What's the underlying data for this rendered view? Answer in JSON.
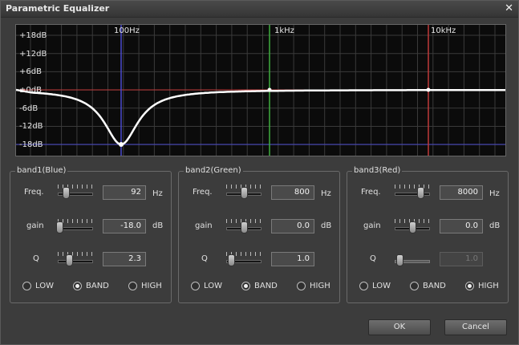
{
  "window": {
    "title": "Parametric Equalizer",
    "close_symbol": "✕"
  },
  "graph": {
    "y_labels": [
      "+18dB",
      "+12dB",
      "+6dB",
      "±0dB",
      "-6dB",
      "-12dB",
      "-18dB"
    ],
    "x_labels": [
      "100Hz",
      "1kHz",
      "10kHz"
    ]
  },
  "bands": [
    {
      "title": "band1(Blue)",
      "freq_label": "Freq.",
      "freq_value": "92",
      "freq_unit": "Hz",
      "gain_label": "gain",
      "gain_value": "-18.0",
      "gain_unit": "dB",
      "q_label": "Q",
      "q_value": "2.3",
      "type_options": [
        "LOW",
        "BAND",
        "HIGH"
      ],
      "selected_type": "BAND",
      "color": "#4a4acc"
    },
    {
      "title": "band2(Green)",
      "freq_label": "Freq.",
      "freq_value": "800",
      "freq_unit": "Hz",
      "gain_label": "gain",
      "gain_value": "0.0",
      "gain_unit": "dB",
      "q_label": "Q",
      "q_value": "1.0",
      "type_options": [
        "LOW",
        "BAND",
        "HIGH"
      ],
      "selected_type": "BAND",
      "color": "#3fae3f"
    },
    {
      "title": "band3(Red)",
      "freq_label": "Freq.",
      "freq_value": "8000",
      "freq_unit": "Hz",
      "gain_label": "gain",
      "gain_value": "0.0",
      "gain_unit": "dB",
      "q_label": "Q",
      "q_value": "1.0",
      "type_options": [
        "LOW",
        "BAND",
        "HIGH"
      ],
      "selected_type": "HIGH",
      "color": "#c03a3a"
    }
  ],
  "buttons": {
    "ok": "OK",
    "cancel": "Cancel"
  },
  "colors": {
    "curve": "#ffffff",
    "grid": "#3a3a3a",
    "band1": "#4a4acc",
    "band2": "#3fae3f",
    "band3": "#c03a3a"
  }
}
